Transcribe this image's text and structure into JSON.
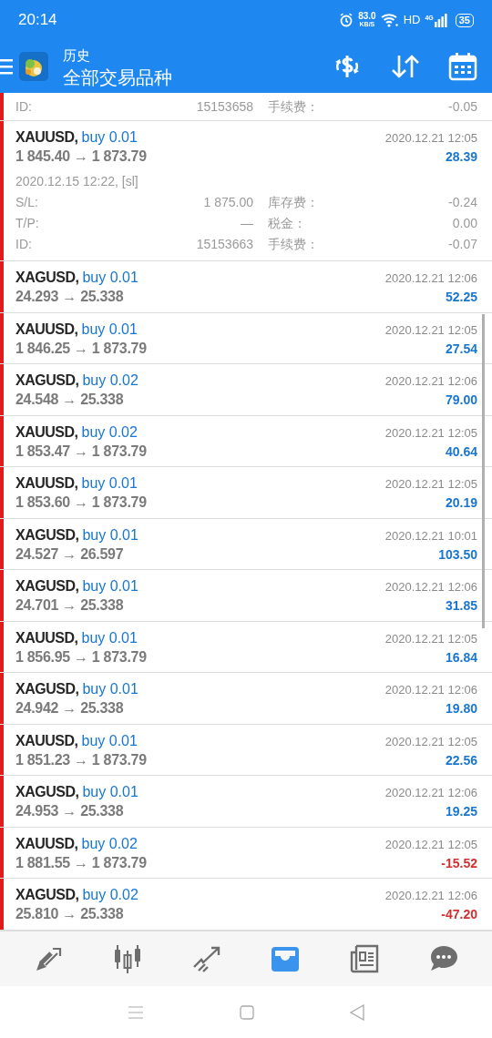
{
  "status_bar": {
    "time": "20:14",
    "speed": "83.0",
    "speed_unit": "KB/S",
    "hd": "HD",
    "network": "4G",
    "battery": "35"
  },
  "toolbar": {
    "title": "历史",
    "subtitle": "全部交易品种"
  },
  "cut_trade": {
    "details": [
      {
        "label": "ID:",
        "value": "15153658",
        "label_2": "手续费：",
        "value_2": "-0.05"
      }
    ]
  },
  "trades": [
    {
      "symbol": "XAUUSD,",
      "side": "buy 0.01",
      "prices": "1 845.40 → 1 873.79",
      "time": "2020.12.21 12:05",
      "profit": "28.39",
      "color": "#1976d2",
      "expanded": true,
      "opened": "2020.12.15 12:22, [sl]",
      "details": [
        {
          "label": "S/L:",
          "value": "1 875.00",
          "label_2": "库存费：",
          "value_2": "-0.24"
        },
        {
          "label": "T/P:",
          "value": "—",
          "label_2": "税金：",
          "value_2": "0.00"
        },
        {
          "label": "ID:",
          "value": "15153663",
          "label_2": "手续费：",
          "value_2": "-0.07"
        }
      ]
    },
    {
      "symbol": "XAGUSD,",
      "side": "buy 0.01",
      "prices": "24.293 → 25.338",
      "time": "2020.12.21 12:06",
      "profit": "52.25",
      "color": "#1976d2",
      "expanded": false
    },
    {
      "symbol": "XAUUSD,",
      "side": "buy 0.01",
      "prices": "1 846.25 → 1 873.79",
      "time": "2020.12.21 12:05",
      "profit": "27.54",
      "color": "#1976d2",
      "expanded": false
    },
    {
      "symbol": "XAGUSD,",
      "side": "buy 0.02",
      "prices": "24.548 → 25.338",
      "time": "2020.12.21 12:06",
      "profit": "79.00",
      "color": "#1976d2",
      "expanded": false
    },
    {
      "symbol": "XAUUSD,",
      "side": "buy 0.02",
      "prices": "1 853.47 → 1 873.79",
      "time": "2020.12.21 12:05",
      "profit": "40.64",
      "color": "#1976d2",
      "expanded": false
    },
    {
      "symbol": "XAUUSD,",
      "side": "buy 0.01",
      "prices": "1 853.60 → 1 873.79",
      "time": "2020.12.21 12:05",
      "profit": "20.19",
      "color": "#1976d2",
      "expanded": false
    },
    {
      "symbol": "XAGUSD,",
      "side": "buy 0.01",
      "prices": "24.527 → 26.597",
      "time": "2020.12.21 10:01",
      "profit": "103.50",
      "color": "#1976d2",
      "expanded": false
    },
    {
      "symbol": "XAGUSD,",
      "side": "buy 0.01",
      "prices": "24.701 → 25.338",
      "time": "2020.12.21 12:06",
      "profit": "31.85",
      "color": "#1976d2",
      "expanded": false
    },
    {
      "symbol": "XAUUSD,",
      "side": "buy 0.01",
      "prices": "1 856.95 → 1 873.79",
      "time": "2020.12.21 12:05",
      "profit": "16.84",
      "color": "#1976d2",
      "expanded": false
    },
    {
      "symbol": "XAGUSD,",
      "side": "buy 0.01",
      "prices": "24.942 → 25.338",
      "time": "2020.12.21 12:06",
      "profit": "19.80",
      "color": "#1976d2",
      "expanded": false
    },
    {
      "symbol": "XAUUSD,",
      "side": "buy 0.01",
      "prices": "1 851.23 → 1 873.79",
      "time": "2020.12.21 12:05",
      "profit": "22.56",
      "color": "#1976d2",
      "expanded": false
    },
    {
      "symbol": "XAGUSD,",
      "side": "buy 0.01",
      "prices": "24.953 → 25.338",
      "time": "2020.12.21 12:06",
      "profit": "19.25",
      "color": "#1976d2",
      "expanded": false
    },
    {
      "symbol": "XAUUSD,",
      "side": "buy 0.02",
      "prices": "1 881.55 → 1 873.79",
      "time": "2020.12.21 12:05",
      "profit": "-15.52",
      "color": "#d32f2f",
      "expanded": false
    },
    {
      "symbol": "XAGUSD,",
      "side": "buy 0.02",
      "prices": "25.810 → 25.338",
      "time": "2020.12.21 12:06",
      "profit": "-47.20",
      "color": "#d32f2f",
      "expanded": false
    }
  ],
  "bottom_nav": [
    {
      "kind": "trade",
      "selected": false
    },
    {
      "kind": "quotes",
      "selected": false
    },
    {
      "kind": "chart",
      "selected": false
    },
    {
      "kind": "history",
      "selected": true
    },
    {
      "kind": "news",
      "selected": false
    },
    {
      "kind": "chat",
      "selected": false
    }
  ]
}
